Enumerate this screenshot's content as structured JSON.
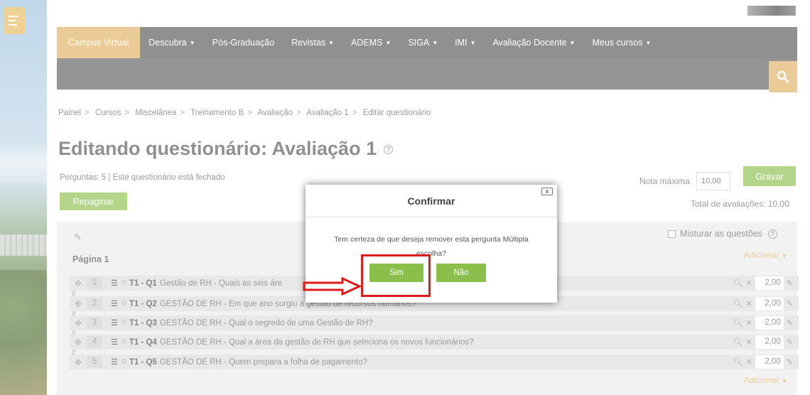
{
  "nav": {
    "brand": "Campus Virtual",
    "items": [
      {
        "label": "Descubra",
        "caret": true
      },
      {
        "label": "Pós-Graduação",
        "caret": false
      },
      {
        "label": "Revistas",
        "caret": true
      },
      {
        "label": "ADEMS",
        "caret": true
      },
      {
        "label": "SIGA",
        "caret": true
      },
      {
        "label": "IMI",
        "caret": true
      },
      {
        "label": "Avaliação Docente",
        "caret": true
      },
      {
        "label": "Meus cursos",
        "caret": true
      }
    ]
  },
  "breadcrumb": [
    "Painel",
    "Cursos",
    "Miscelânea",
    "Treinamento B",
    "Avaliação",
    "Avaliação 1",
    "Editar questionário"
  ],
  "page": {
    "title": "Editando questionário: Avaliação 1",
    "info": "Perguntas: 5 | Este questionário está fechado",
    "repaginar": "Repaginar",
    "nota_label": "Nota máxima",
    "nota_value": "10,00",
    "gravar": "Gravar",
    "total": "Total de avaliações: 10,00",
    "shuffle": "Misturar as questões",
    "adicionar": "Adicionar",
    "pagina": "Página 1"
  },
  "questions": [
    {
      "num": "1",
      "name": "T1 - Q1",
      "text": "Gestão de RH - Quais as seis áre",
      "grade": "2,00"
    },
    {
      "num": "2",
      "name": "T1 - Q2",
      "text": "GESTÃO DE RH - Em que ano surgiu a gestão de recursos humanos?",
      "grade": "2,00"
    },
    {
      "num": "3",
      "name": "T1 - Q3",
      "text": "GESTÃO DE RH - Qual o segredo de uma Gestão de RH?",
      "grade": "2,00"
    },
    {
      "num": "4",
      "name": "T1 - Q4",
      "text": "GESTÃO DE RH - Qual a área da gestão de RH que seleciona os novos funcionários?",
      "grade": "2,00"
    },
    {
      "num": "5",
      "name": "T1 - Q5",
      "text": "GESTÃO DE RH - Quem prepara a folha de pagamento?",
      "grade": "2,00"
    }
  ],
  "dialog": {
    "title": "Confirmar",
    "message": "Tem certeza de que deseja remover esta pergunta Múltipla escolha?",
    "yes": "Sim",
    "no": "Não",
    "close": "x"
  },
  "colors": {
    "accent": "#e0b060",
    "green": "#8bbf4b",
    "nav": "#555555",
    "highlight": "#e01a1a"
  }
}
